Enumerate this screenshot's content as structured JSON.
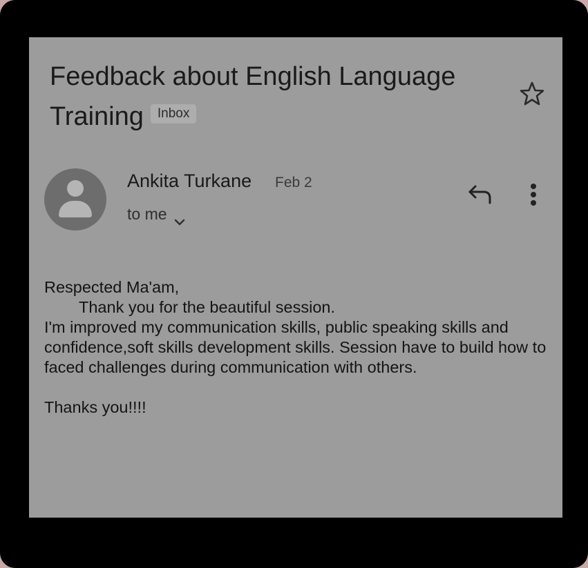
{
  "email": {
    "subject": "Feedback about English Language Training",
    "label_badge": "Inbox",
    "sender_name": "Ankita Turkane",
    "date": "Feb 2",
    "recipient": "to me",
    "body": {
      "greeting": "Respected Ma'am,",
      "thanks_line": "Thank you for  the beautiful session.",
      "paragraph": "I'm improved my communication skills, public speaking skills and confidence,soft skills development skills. Session have to build how to faced challenges during communication with  others.",
      "closing": "Thanks you!!!!"
    }
  },
  "icons": {
    "star": "star-icon",
    "avatar": "avatar-placeholder-icon",
    "reply": "reply-icon",
    "more": "more-vert-icon",
    "expand": "chevron-down-icon"
  },
  "colors": {
    "screen_background": "#9c9c9c",
    "frame": "#000000",
    "avatar": "#6d6d6d",
    "text": "#1a1a1a"
  }
}
